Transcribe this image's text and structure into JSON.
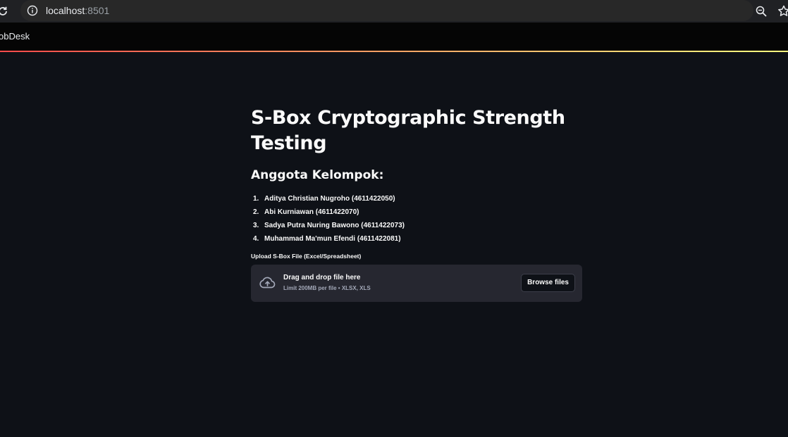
{
  "browser": {
    "url_host": "localhost",
    "url_port": ":8501",
    "bookmark": "obDesk"
  },
  "page": {
    "title": "S-Box Cryptographic Strength Testing",
    "subtitle": "Anggota Kelompok:",
    "members": [
      {
        "num": "1.",
        "text": "Aditya Christian Nugroho (4611422050)"
      },
      {
        "num": "2.",
        "text": "Abi Kurniawan (4611422070)"
      },
      {
        "num": "3.",
        "text": "Sadya Putra Nuring Bawono (4611422073)"
      },
      {
        "num": "4.",
        "text": "Muhammad Ma'mun Efendi (4611422081)"
      }
    ],
    "uploader": {
      "label": "Upload S-Box File (Excel/Spreadsheet)",
      "title": "Drag and drop file here",
      "limit": "Limit 200MB per file • XLSX, XLS",
      "button": "Browse files",
      "icon": "cloud-upload-icon"
    }
  },
  "colors": {
    "background": "#0e1117",
    "dropzone": "#262730",
    "text": "#fafafa",
    "accent_start": "#ff4b4b",
    "accent_end": "#fffd80"
  }
}
